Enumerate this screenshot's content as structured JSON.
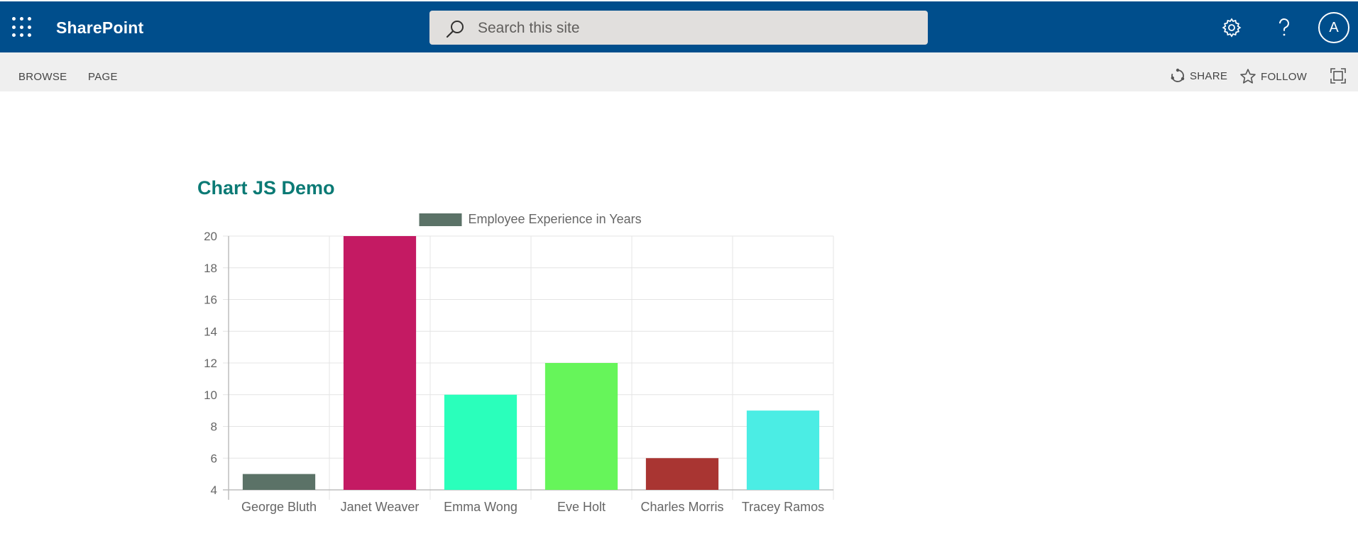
{
  "suitebar": {
    "app_name": "SharePoint",
    "search_placeholder": "Search this site",
    "avatar_initial": "A",
    "icons": [
      "waffle-icon",
      "search-icon",
      "settings-gear-icon",
      "help-icon"
    ]
  },
  "ribbon": {
    "tabs": [
      "BROWSE",
      "PAGE"
    ],
    "share_label": "SHARE",
    "follow_label": "FOLLOW",
    "icons": [
      "share-icon",
      "star-icon",
      "focus-mode-icon"
    ]
  },
  "page": {
    "title": "Chart JS Demo"
  },
  "colors": {
    "suitebar_bg": "#004e8c",
    "ribbon_bg": "#efefef",
    "title_color": "#0b7a75"
  },
  "chart_data": {
    "type": "bar",
    "title": "",
    "legend": [
      "Employee Experience in Years"
    ],
    "legend_position": "top-center",
    "categories": [
      "George Bluth",
      "Janet Weaver",
      "Emma Wong",
      "Eve Holt",
      "Charles Morris",
      "Tracey Ramos"
    ],
    "series": [
      {
        "name": "Employee Experience in Years",
        "values": [
          5,
          20,
          10,
          12,
          6,
          9
        ],
        "colors": [
          "#5b7267",
          "#c41a63",
          "#2affbb",
          "#66f55a",
          "#a93532",
          "#4bede4"
        ]
      }
    ],
    "legend_swatch_color": "#5b7267",
    "ylim": [
      4,
      20
    ],
    "yticks": [
      20,
      18,
      16,
      14,
      12,
      10,
      8,
      6,
      4
    ],
    "grid": true,
    "xlabel": "",
    "ylabel": ""
  }
}
